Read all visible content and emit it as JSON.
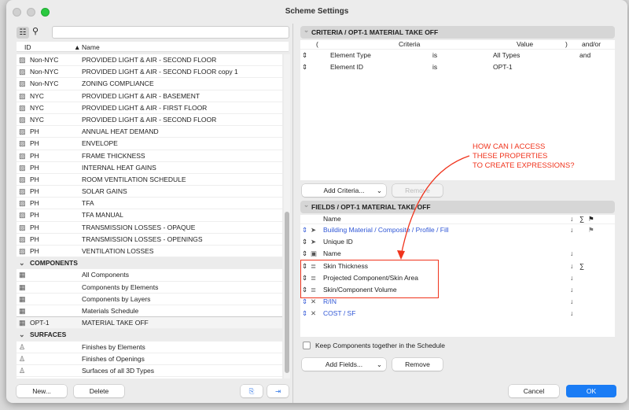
{
  "window": {
    "title": "Scheme Settings"
  },
  "left": {
    "columns": {
      "id": "ID",
      "name": "Name",
      "sort": "▲"
    },
    "rows": [
      {
        "type": "item",
        "icon": "hatch",
        "id": "Non-NYC",
        "name": "PROVIDED LIGHT & AIR - SECOND FLOOR"
      },
      {
        "type": "item",
        "icon": "hatch",
        "id": "Non-NYC",
        "name": "PROVIDED LIGHT & AIR - SECOND FLOOR copy 1"
      },
      {
        "type": "item",
        "icon": "hatch",
        "id": "Non-NYC",
        "name": "ZONING COMPLIANCE"
      },
      {
        "type": "item",
        "icon": "hatch",
        "id": "NYC",
        "name": "PROVIDED LIGHT & AIR - BASEMENT"
      },
      {
        "type": "item",
        "icon": "hatch",
        "id": "NYC",
        "name": "PROVIDED LIGHT & AIR - FIRST FLOOR"
      },
      {
        "type": "item",
        "icon": "hatch",
        "id": "NYC",
        "name": "PROVIDED LIGHT & AIR - SECOND FLOOR"
      },
      {
        "type": "item",
        "icon": "hatch",
        "id": "PH",
        "name": "ANNUAL HEAT DEMAND"
      },
      {
        "type": "item",
        "icon": "hatch",
        "id": "PH",
        "name": "ENVELOPE"
      },
      {
        "type": "item",
        "icon": "hatch",
        "id": "PH",
        "name": "FRAME THICKNESS"
      },
      {
        "type": "item",
        "icon": "hatch",
        "id": "PH",
        "name": "INTERNAL HEAT GAINS"
      },
      {
        "type": "item",
        "icon": "hatch",
        "id": "PH",
        "name": "ROOM VENTILATION SCHEDULE"
      },
      {
        "type": "item",
        "icon": "hatch",
        "id": "PH",
        "name": "SOLAR GAINS"
      },
      {
        "type": "item",
        "icon": "hatch",
        "id": "PH",
        "name": "TFA"
      },
      {
        "type": "item",
        "icon": "hatch",
        "id": "PH",
        "name": "TFA MANUAL"
      },
      {
        "type": "item",
        "icon": "hatch",
        "id": "PH",
        "name": "TRANSMISSION LOSSES - OPAQUE"
      },
      {
        "type": "item",
        "icon": "hatch",
        "id": "PH",
        "name": "TRANSMISSION LOSSES - OPENINGS"
      },
      {
        "type": "item",
        "icon": "hatch",
        "id": "PH",
        "name": "VENTILATION LOSSES"
      },
      {
        "type": "group",
        "name": "COMPONENTS"
      },
      {
        "type": "item",
        "icon": "bricks",
        "id": "",
        "name": "All Components"
      },
      {
        "type": "item",
        "icon": "bricks",
        "id": "",
        "name": "Components by Elements"
      },
      {
        "type": "item",
        "icon": "bricks",
        "id": "",
        "name": "Components by Layers"
      },
      {
        "type": "item",
        "icon": "bricks",
        "id": "",
        "name": "Materials Schedule"
      },
      {
        "type": "item",
        "icon": "bricks",
        "id": "OPT-1",
        "name": "MATERIAL TAKE OFF",
        "selected": true
      },
      {
        "type": "group",
        "name": "SURFACES"
      },
      {
        "type": "item",
        "icon": "brush",
        "id": "",
        "name": "Finishes by Elements"
      },
      {
        "type": "item",
        "icon": "brush",
        "id": "",
        "name": "Finishes of Openings"
      },
      {
        "type": "item",
        "icon": "brush",
        "id": "",
        "name": "Surfaces of all 3D Types"
      }
    ],
    "buttons": {
      "new": "New...",
      "delete": "Delete"
    }
  },
  "criteria": {
    "title": "CRITERIA / OPT-1 MATERIAL TAKE OFF",
    "columns": {
      "open": "(",
      "criteria": "Criteria",
      "value": "Value",
      "close": ")",
      "andor": "and/or"
    },
    "rows": [
      {
        "criteria": "Element Type",
        "op": "is",
        "value": "All Types",
        "andor": "and"
      },
      {
        "criteria": "Element ID",
        "op": "is",
        "value": "OPT-1",
        "andor": ""
      }
    ],
    "add_label": "Add Criteria...",
    "remove_label": "Remove"
  },
  "fields": {
    "title": "FIELDS / OPT-1 MATERIAL TAKE OFF",
    "columns": {
      "name": "Name",
      "sort": "↓",
      "sum": "∑",
      "flag": "⚑"
    },
    "rows": [
      {
        "name": "Building Material / Composite / Profile / Fill",
        "blue": true,
        "icon": "cursor",
        "sort": "↓",
        "sum": "",
        "flag": "⚑"
      },
      {
        "name": "Unique ID",
        "blue": false,
        "icon": "cursor",
        "sort": "",
        "sum": "",
        "flag": ""
      },
      {
        "name": "Name",
        "blue": false,
        "icon": "box",
        "sort": "↓",
        "sum": "",
        "flag": ""
      },
      {
        "name": "Skin Thickness",
        "blue": false,
        "icon": "skin",
        "sort": "↓",
        "sum": "∑",
        "flag": ""
      },
      {
        "name": "Projected Component/Skin Area",
        "blue": false,
        "icon": "skin",
        "sort": "↓",
        "sum": "",
        "flag": ""
      },
      {
        "name": "Skin/Component Volume",
        "blue": false,
        "icon": "skin",
        "sort": "↓",
        "sum": "",
        "flag": ""
      },
      {
        "name": "R/IN",
        "blue": true,
        "icon": "expression",
        "sort": "↓",
        "sum": "",
        "flag": ""
      },
      {
        "name": "COST / SF",
        "blue": true,
        "icon": "expression",
        "sort": "↓",
        "sum": "",
        "flag": ""
      }
    ],
    "keep_together": "Keep Components together in the Schedule",
    "add_label": "Add Fields...",
    "remove_label": "Remove"
  },
  "annotation": {
    "lines": [
      "HOW CAN I ACCESS",
      "THESE PROPERTIES",
      "TO CREATE EXPRESSIONS?"
    ],
    "color": "#f0331c"
  },
  "footer": {
    "cancel": "Cancel",
    "ok": "OK"
  }
}
